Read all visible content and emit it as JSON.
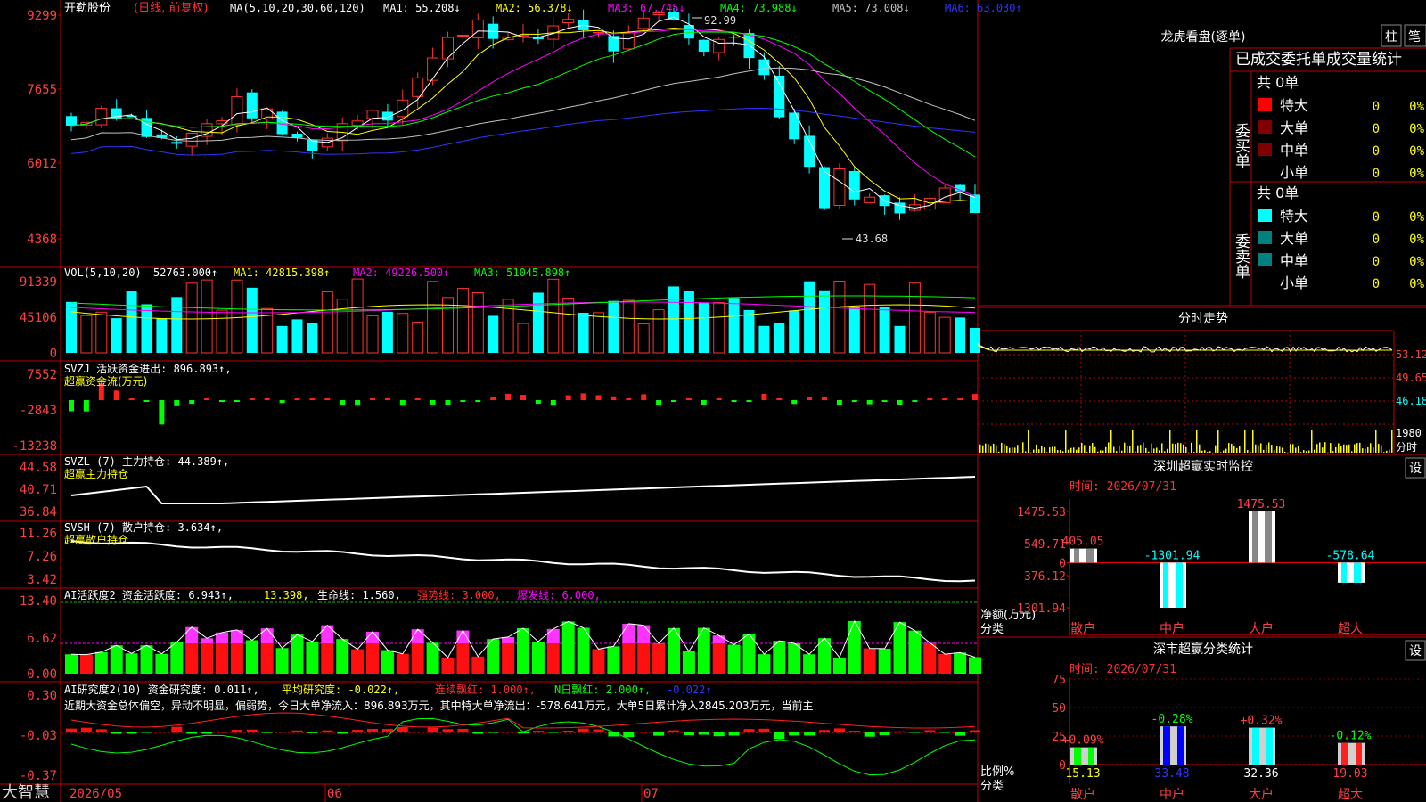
{
  "stock": {
    "name": "开勒股份",
    "mode": "(日线, 前复权)",
    "ma_label": "MA(5,10,20,30,60,120)",
    "ma": [
      {
        "label": "MA1:",
        "value": "55.208",
        "arrow": "↓",
        "color": "#ffffff"
      },
      {
        "label": "MA2:",
        "value": "56.378",
        "arrow": "↓",
        "color": "#ffff00"
      },
      {
        "label": "MA3:",
        "value": "67.745",
        "arrow": "↓",
        "color": "#ff00ff"
      },
      {
        "label": "MA4:",
        "value": "73.988",
        "arrow": "↓",
        "color": "#00ff00"
      },
      {
        "label": "MA5:",
        "value": "73.008",
        "arrow": "↓",
        "color": "#c0c0c0"
      },
      {
        "label": "MA6:",
        "value": "63.030",
        "arrow": "↑",
        "color": "#3333ff"
      }
    ],
    "high_label": "92.99",
    "low_label": "43.68"
  },
  "axis": {
    "price": [
      "9299",
      "7655",
      "6012",
      "4368"
    ],
    "vol": [
      "91339",
      "45106",
      "0"
    ],
    "svzj": [
      "7552",
      "-2843",
      "-13238"
    ],
    "svzl": [
      "44.58",
      "40.71",
      "36.84"
    ],
    "svsh": [
      "11.26",
      "7.26",
      "3.42"
    ],
    "ai": [
      "13.40",
      "6.62",
      "0.00"
    ],
    "yj": [
      "0.30",
      "-0.03",
      "-0.37"
    ],
    "dates": [
      "2026/05",
      "06",
      "07"
    ]
  },
  "panels": {
    "vol": {
      "title": "VOL(5,10,20)",
      "v": "52763.000↑",
      "ma1": "MA1: 42815.398↑",
      "ma2": "MA2: 49226.500↑",
      "ma3": "MA3: 51045.898↑"
    },
    "svzj": {
      "title": "SVZJ  活跃资金进出: 896.893↑,",
      "sub": "超赢资金流(万元)"
    },
    "svzl": {
      "title": "SVZL (7) 主力持仓: 44.389↑,",
      "sub": "超赢主力持仓"
    },
    "svsh": {
      "title": "SVSH (7) 散户持仓: 3.634↑,",
      "sub": "超赢散户持仓"
    },
    "ai": {
      "title": "AI活跃度2 资金活跃度: 6.943↑,",
      "v2": "13.398,",
      "life": "生命线: 1.560,",
      "strong": "强势线: 3.000,",
      "burst": "爆发线: 6.000,"
    },
    "yj": {
      "title": "AI研究度2(10) 资金研究度: 0.011↑,",
      "avg": "平均研究度: -0.022↑,",
      "cont": "连续飘红: 1.000↑,",
      "nday": "N日飘红: 2.000↑,",
      "last": "-0.022↑"
    }
  },
  "commentary": "近期大资金总体偏空，异动不明显，偏弱势，今日大单净流入：896.893万元，其中特大单净流出：-578.641万元，大单5日累计净入2845.203万元，当前主",
  "brand": "大智慧",
  "right": {
    "lhb_title": "龙虎看盘(逐单)",
    "btn_zhu": "柱",
    "btn_bi": "笔",
    "tabs": "已成交委托单成交量统计",
    "buy": {
      "label": "委买单",
      "total": "共 0单",
      "rows": [
        {
          "name": "特大",
          "n": "0",
          "p": "0%"
        },
        {
          "name": "大单",
          "n": "0",
          "p": "0%"
        },
        {
          "name": "中单",
          "n": "0",
          "p": "0%"
        },
        {
          "name": "小单",
          "n": "0",
          "p": "0%"
        }
      ]
    },
    "sell": {
      "label": "委卖单",
      "total": "共 0单",
      "rows": [
        {
          "name": "特大",
          "n": "0",
          "p": "0%"
        },
        {
          "name": "大单",
          "n": "0",
          "p": "0%"
        },
        {
          "name": "中单",
          "n": "0",
          "p": "0%"
        },
        {
          "name": "小单",
          "n": "0",
          "p": "0%"
        }
      ]
    },
    "fs_title": "分时走势",
    "fs_axis": [
      "53.12",
      "49.65",
      "46.18",
      "1980",
      "分时"
    ],
    "monitor": {
      "title": "深圳超赢实时监控",
      "set": "设",
      "time": "时间: 2026/07/31",
      "axis": [
        "1475.53",
        "549.71",
        "0",
        "-376.12",
        "-1301.94"
      ],
      "unit": "净额(万元)",
      "cat": "分类",
      "labels": [
        "散户",
        "中户",
        "大户",
        "超大"
      ],
      "values": [
        "405.05",
        "-1301.94",
        "1475.53",
        "-578.64"
      ]
    },
    "stats": {
      "title": "深市超赢分类统计",
      "set": "设",
      "time": "时间: 2026/07/31",
      "axis": [
        "75",
        "50",
        "25",
        "0"
      ],
      "unit": "比例%",
      "cat": "分类",
      "labels": [
        "散户",
        "中户",
        "大户",
        "超大"
      ],
      "top": [
        "+0.09%",
        "-0.28%",
        "+0.32%",
        "-0.12%"
      ],
      "values": [
        "15.13",
        "33.48",
        "32.36",
        "19.03"
      ]
    }
  },
  "colors": {
    "up": "#ff3232",
    "down": "#00ffff",
    "bg": "#000000",
    "grid": "#800000",
    "text": "#c0c0c0"
  },
  "chart_data": {
    "type": "candlestick",
    "title": "开勒股份 日线",
    "ylim": [
      43.68,
      92.99
    ],
    "x": [
      "2026/05",
      "06",
      "07"
    ],
    "series": [
      {
        "name": "MA1",
        "value": 55.208
      },
      {
        "name": "MA2",
        "value": 56.378
      },
      {
        "name": "MA3",
        "value": 67.745
      },
      {
        "name": "MA4",
        "value": 73.988
      },
      {
        "name": "MA5",
        "value": 73.008
      },
      {
        "name": "MA6",
        "value": 63.03
      }
    ],
    "monitor": {
      "categories": [
        "散户",
        "中户",
        "大户",
        "超大"
      ],
      "values": [
        405.05,
        -1301.94,
        1475.53,
        -578.64
      ]
    },
    "stats": {
      "categories": [
        "散户",
        "中户",
        "大户",
        "超大"
      ],
      "values": [
        15.13,
        33.48,
        32.36,
        19.03
      ],
      "changes": [
        0.09,
        -0.28,
        0.32,
        -0.12
      ]
    }
  }
}
